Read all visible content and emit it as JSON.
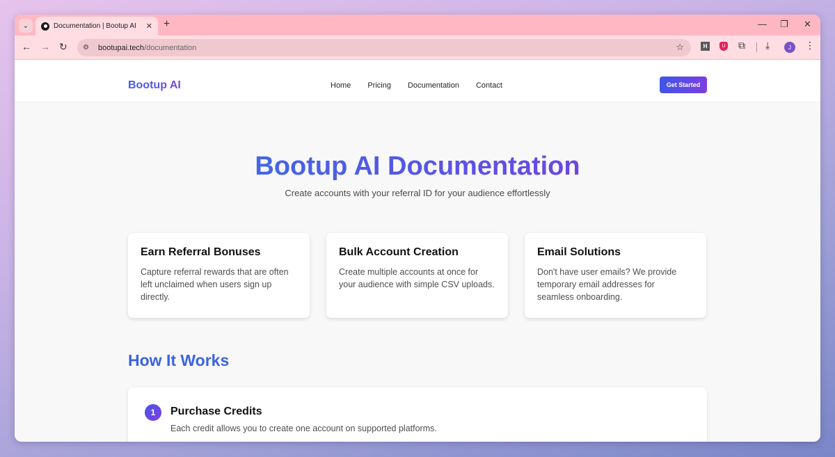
{
  "browser": {
    "tab_title": "Documentation | Bootup AI",
    "tab_close": "✕",
    "new_tab": "+",
    "url_host": "bootupai.tech",
    "url_path": "/documentation",
    "ext_h_label": "H",
    "avatar_initial": "J"
  },
  "header": {
    "logo": "Bootup AI",
    "nav": [
      "Home",
      "Pricing",
      "Documentation",
      "Contact"
    ],
    "cta": "Get Started"
  },
  "hero": {
    "title": "Bootup AI Documentation",
    "subtitle": "Create accounts with your referral ID for your audience effortlessly"
  },
  "features": [
    {
      "title": "Earn Referral Bonuses",
      "text": "Capture referral rewards that are often left unclaimed when users sign up directly."
    },
    {
      "title": "Bulk Account Creation",
      "text": "Create multiple accounts at once for your audience with simple CSV uploads."
    },
    {
      "title": "Email Solutions",
      "text": "Don't have user emails? We provide temporary email addresses for seamless onboarding."
    }
  ],
  "how_it_works": {
    "title": "How It Works",
    "steps": [
      {
        "number": "1",
        "title": "Purchase Credits",
        "text": "Each credit allows you to create one account on supported platforms."
      }
    ]
  },
  "colors": {
    "tab_strip": "#ffb8c3",
    "toolbar": "#ffdde2",
    "brand_blue": "#3b63e0",
    "brand_purple": "#7d3ee3"
  }
}
